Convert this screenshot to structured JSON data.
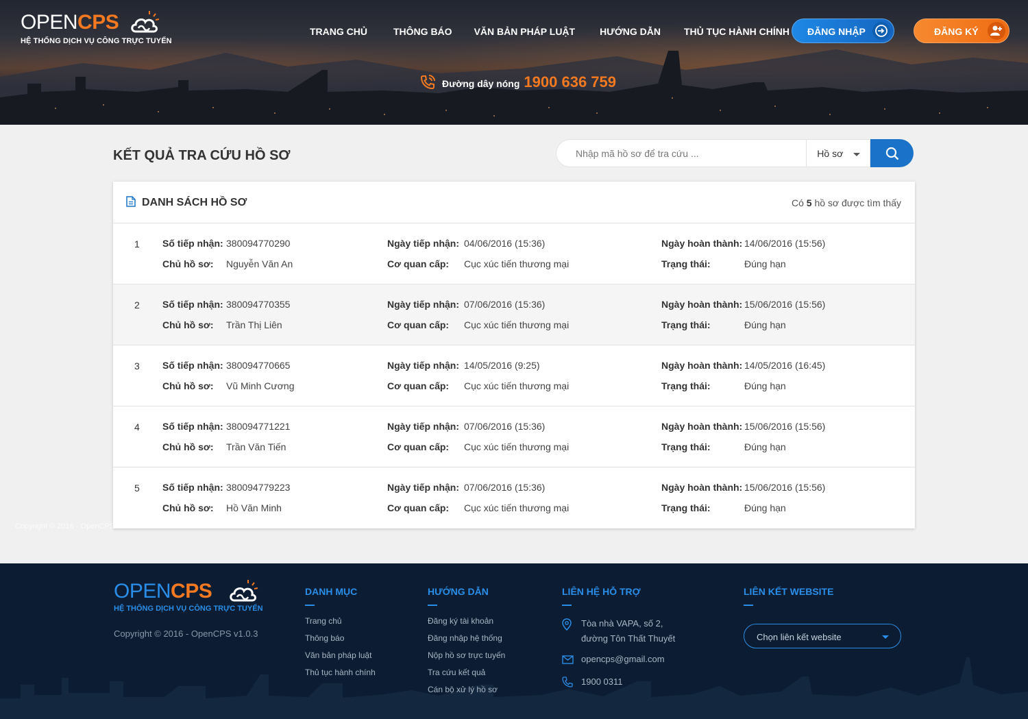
{
  "brand": {
    "logo_open": "OPEN",
    "logo_cps": "CPS",
    "tagline": "HỆ THỐNG DỊCH VỤ CÔNG TRỰC TUYẾN"
  },
  "nav": [
    "TRANG CHỦ",
    "THÔNG BÁO",
    "VĂN BẢN PHÁP LUẬT",
    "HƯỚNG DẪN",
    "THỦ TỤC HÀNH CHÍNH"
  ],
  "auth": {
    "login": "ĐĂNG NHẬP",
    "register": "ĐĂNG KÝ"
  },
  "hotline": {
    "label": "Đường dây nóng",
    "number": "1900 636 759"
  },
  "page_title": "KẾT QUẢ TRA CỨU HỒ SƠ",
  "search": {
    "placeholder": "Nhập mã hồ sơ để tra cứu ...",
    "type": "Hồ sơ"
  },
  "list": {
    "title": "DANH SÁCH HỒ SƠ",
    "count_prefix": "Có",
    "count": "5",
    "count_suffix": "hồ sơ được tìm thấy",
    "labels": {
      "receipt_no": "Số tiếp nhận:",
      "owner": "Chủ hồ sơ:",
      "received_date": "Ngày tiếp nhận:",
      "agency": "Cơ quan cấp:",
      "completed_date": "Ngày hoàn thành:",
      "status": "Trạng thái:"
    },
    "rows": [
      {
        "index": "1",
        "receipt_no": "380094770290",
        "owner": "Nguyễn Văn An",
        "received_date": "04/06/2016 (15:36)",
        "agency": "Cục xúc tiến thương mại",
        "completed_date": "14/06/2016 (15:56)",
        "status": "Đúng hạn"
      },
      {
        "index": "2",
        "receipt_no": "380094770355",
        "owner": "Trần Thị Liên",
        "received_date": "07/06/2016 (15:36)",
        "agency": "Cục xúc tiến thương mại",
        "completed_date": "15/06/2016 (15:56)",
        "status": "Đúng hạn"
      },
      {
        "index": "3",
        "receipt_no": "380094770665",
        "owner": "Vũ Minh Cương",
        "received_date": "14/05/2016 (9:25)",
        "agency": "Cục xúc tiến thương mại",
        "completed_date": "14/05/2016 (16:45)",
        "status": "Đúng hạn"
      },
      {
        "index": "4",
        "receipt_no": "380094771221",
        "owner": "Trần Văn Tiến",
        "received_date": "07/06/2016 (15:36)",
        "agency": "Cục xúc tiến thương mại",
        "completed_date": "15/06/2016 (15:56)",
        "status": "Đúng hạn"
      },
      {
        "index": "5",
        "receipt_no": "380094779223",
        "owner": "Hồ Văn Minh",
        "received_date": "07/06/2016 (15:36)",
        "agency": "Cục xúc tiến thương mại",
        "completed_date": "15/06/2016 (15:56)",
        "status": "Đúng hạn"
      }
    ]
  },
  "footer": {
    "copyright": "Copyright © 2016 - OpenCPS v1.0.3",
    "ghost_copyright": "Copyright © 2016 - OpenCPS v1.0.3",
    "danh_muc": {
      "title": "DANH MỤC",
      "links": [
        "Trang chủ",
        "Thông báo",
        "Văn bản pháp luật",
        "Thủ tục hành chính"
      ]
    },
    "huong_dan": {
      "title": "HƯỚNG DẪN",
      "links": [
        "Đăng ký tài khoản",
        "Đăng nhập hệ thống",
        "Nộp hồ sơ trực tuyến",
        "Tra cứu kết quả",
        "Cán bộ xử lý hồ sơ"
      ]
    },
    "lien_he": {
      "title": "LIÊN HỆ HỖ TRỢ",
      "address_1": "Tòa nhà VAPA, số 2,",
      "address_2": "đường Tôn Thất Thuyết",
      "email": "opencps@gmail.com",
      "phone": "1900 0311"
    },
    "lien_ket": {
      "title": "LIÊN KẾT WEBSITE",
      "select_placeholder": "Chọn liên kết website"
    }
  },
  "colors": {
    "brand_orange": "#f47920",
    "brand_blue": "#1a73c9",
    "footer_bg": "#0c1d33"
  }
}
